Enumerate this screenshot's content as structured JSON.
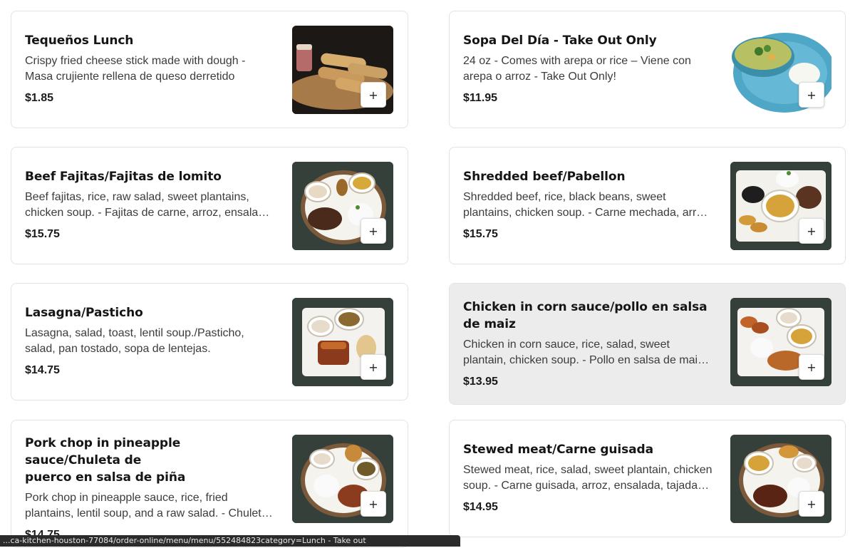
{
  "menu": {
    "items": [
      {
        "name": "Tequeños Lunch",
        "description": "Crispy fried cheese stick made with dough - Masa crujiente rellena de queso derretido",
        "price": "$1.85",
        "add_label": "+",
        "photo_icon": "tequenos-photo"
      },
      {
        "name": "Sopa Del Día - Take Out Only",
        "description": "24 oz - Comes with arepa or rice – Viene con arepa o arroz - Take Out Only!",
        "price": "$11.95",
        "add_label": "+",
        "photo_icon": "soup-photo"
      },
      {
        "name": "Beef Fajitas/Fajitas de lomito",
        "description": "Beef fajitas, rice, raw salad, sweet plantains, chicken soup. - Fajitas de carne, arroz, ensalada cruda, tajadas, sopa de pollo.",
        "price": "$15.75",
        "add_label": "+",
        "photo_icon": "fajitas-plate-photo"
      },
      {
        "name": "Shredded beef/Pabellon",
        "description": "Shredded beef, rice, black beans, sweet plantains, chicken soup. - Carne mechada, arroz, caraotas negras, tajadas, sopa de pollo.",
        "price": "$15.75",
        "add_label": "+",
        "photo_icon": "pabellon-plate-photo"
      },
      {
        "name": "Lasagna/Pasticho",
        "description": "Lasagna, salad, toast, lentil soup./Pasticho, salad, pan tostado, sopa de lentejas.",
        "price": "$14.75",
        "add_label": "+",
        "photo_icon": "lasagna-plate-photo"
      },
      {
        "name": "Chicken in corn sauce/pollo en salsa de maiz",
        "description": "Chicken in corn sauce, rice, salad, sweet plantain, chicken soup. - Pollo en salsa de maiz, arroz, ensalada, tajadas, sopa de pollo.",
        "price": "$13.95",
        "add_label": "+",
        "photo_icon": "chicken-corn-plate-photo"
      },
      {
        "name": "Pork chop in pineapple sauce/Chuleta de puerco en salsa de piña",
        "description": "Pork chop in pineapple sauce, rice, fried plantains, lentil soup, and a raw salad. - Chuleta de puerco en salsa de piña, arroz, tajadas, sopa de lentejas y ensalada cruda.",
        "price": "$14.75",
        "add_label": "+",
        "photo_icon": "pork-chop-plate-photo"
      },
      {
        "name": "Stewed meat/Carne guisada",
        "description": "Stewed meat, rice, salad, sweet plantain, chicken soup. - Carne guisada, arroz, ensalada, tajadas, sopa de pollo.",
        "price": "$14.95",
        "add_label": "+",
        "photo_icon": "stewed-meat-plate-photo"
      }
    ]
  },
  "status_bar": {
    "url": "...ca-kitchen-houston-77084/order-online/menu/menu/552484823category=Lunch - Take out"
  }
}
